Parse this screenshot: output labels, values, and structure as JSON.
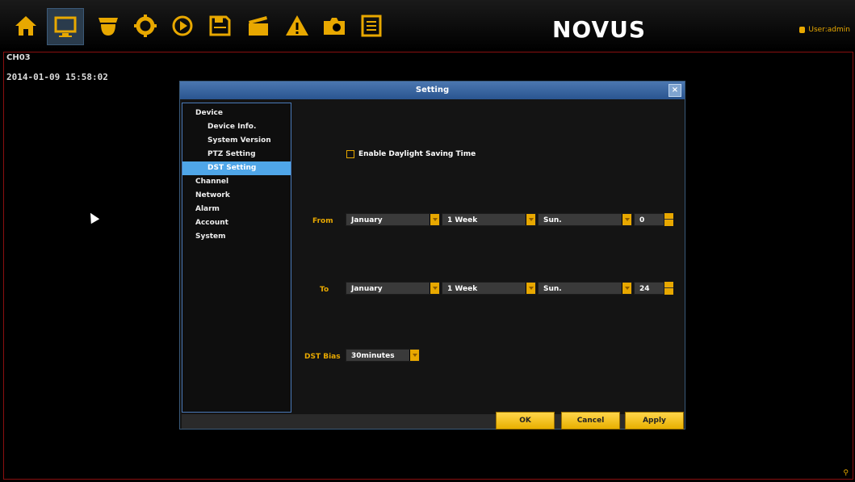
{
  "toolbar": {
    "icons": [
      "home-icon",
      "monitor-icon",
      "camera-dome-icon",
      "gear-icon",
      "play-icon",
      "save-icon",
      "record-icon",
      "alarm-icon",
      "snapshot-icon",
      "log-icon"
    ],
    "logo": "NOVUS",
    "user_label": "User:admin",
    "accent_color": "#e8a800"
  },
  "screen": {
    "channel": "CH03",
    "datetime": "2014-01-09 15:58:02"
  },
  "dialog": {
    "title": "Setting",
    "close_label": "×",
    "tree": [
      {
        "label": "Device",
        "level": 0,
        "selected": false
      },
      {
        "label": "Device Info.",
        "level": 1,
        "selected": false
      },
      {
        "label": "System Version",
        "level": 1,
        "selected": false
      },
      {
        "label": "PTZ Setting",
        "level": 1,
        "selected": false
      },
      {
        "label": "DST Setting",
        "level": 1,
        "selected": true
      },
      {
        "label": "Channel",
        "level": 0,
        "selected": false
      },
      {
        "label": "Network",
        "level": 0,
        "selected": false
      },
      {
        "label": "Alarm",
        "level": 0,
        "selected": false
      },
      {
        "label": "Account",
        "level": 0,
        "selected": false
      },
      {
        "label": "System",
        "level": 0,
        "selected": false
      }
    ],
    "enable_dst_label": "Enable Daylight Saving Time",
    "enable_dst_checked": false,
    "from": {
      "label": "From",
      "month": "January",
      "week": "1 Week",
      "day": "Sun.",
      "hour": "0"
    },
    "to": {
      "label": "To",
      "month": "January",
      "week": "1 Week",
      "day": "Sun.",
      "hour": "24"
    },
    "dst_bias": {
      "label": "DST Bias",
      "value": "30minutes"
    },
    "buttons": {
      "ok": "OK",
      "cancel": "Cancel",
      "apply": "Apply"
    }
  }
}
